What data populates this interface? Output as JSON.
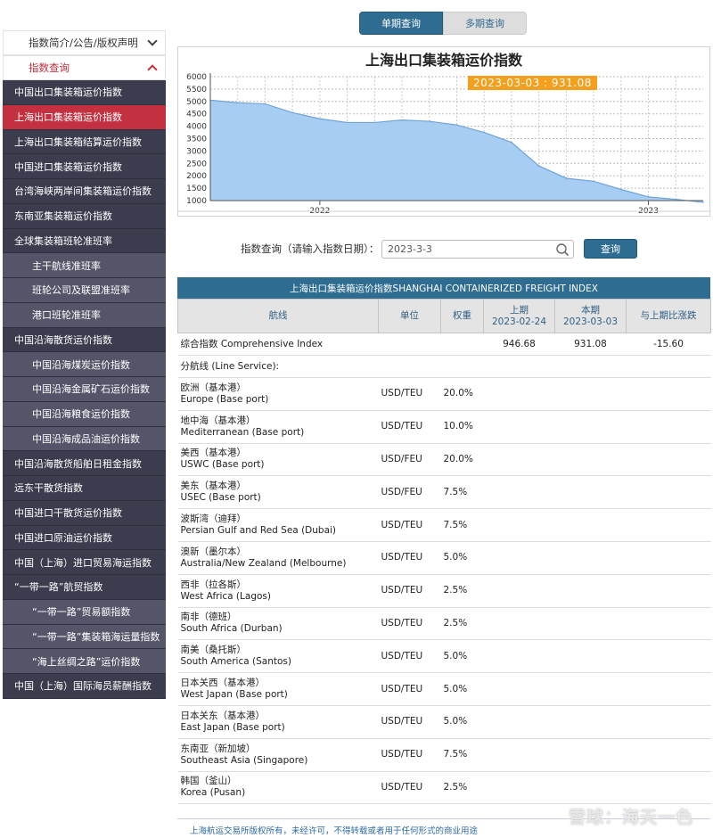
{
  "sidebar": {
    "top": [
      {
        "label": "指数简介/公告/版权声明",
        "active": false
      },
      {
        "label": "指数查询",
        "active": true
      }
    ],
    "items": [
      {
        "label": "中国出口集装箱运价指数",
        "level": 1
      },
      {
        "label": "上海出口集装箱运价指数",
        "level": 1,
        "selected": true
      },
      {
        "label": "上海出口集装箱结算运价指数",
        "level": 1
      },
      {
        "label": "中国进口集装箱运价指数",
        "level": 1
      },
      {
        "label": "台湾海峡两岸间集装箱运价指数",
        "level": 1
      },
      {
        "label": "东南亚集装箱运价指数",
        "level": 1
      },
      {
        "label": "全球集装箱班轮准班率",
        "level": 1
      },
      {
        "label": "主干航线准班率",
        "level": 2
      },
      {
        "label": "班轮公司及联盟准班率",
        "level": 2
      },
      {
        "label": "港口班轮准班率",
        "level": 2
      },
      {
        "label": "中国沿海散货运价指数",
        "level": 1
      },
      {
        "label": "中国沿海煤炭运价指数",
        "level": 2
      },
      {
        "label": "中国沿海金属矿石运价指数",
        "level": 2
      },
      {
        "label": "中国沿海粮食运价指数",
        "level": 2
      },
      {
        "label": "中国沿海成品油运价指数",
        "level": 2
      },
      {
        "label": "中国沿海散货船舶日租金指数",
        "level": 1
      },
      {
        "label": "远东干散货指数",
        "level": 1
      },
      {
        "label": "中国进口干散货运价指数",
        "level": 1
      },
      {
        "label": "中国进口原油运价指数",
        "level": 1
      },
      {
        "label": "中国（上海）进口贸易海运指数",
        "level": 1
      },
      {
        "label": "“一带一路”航贸指数",
        "level": 1
      },
      {
        "label": "“一带一路”贸易额指数",
        "level": 2
      },
      {
        "label": "“一带一路”集装箱海运量指数",
        "level": 2
      },
      {
        "label": "“海上丝绸之路”运价指数",
        "level": 2
      },
      {
        "label": "中国（上海）国际海员薪酬指数",
        "level": 1
      }
    ]
  },
  "tabs": {
    "single": "单期查询",
    "multi": "多期查询"
  },
  "chart_data": {
    "type": "area",
    "title": "上海出口集装箱运价指数",
    "tooltip": "2023-03-03 : 931.08",
    "ylim": [
      1000,
      6000
    ],
    "yticks": [
      1000,
      1500,
      2000,
      2500,
      3000,
      3500,
      4000,
      4500,
      5000,
      5500,
      6000
    ],
    "xtick_labels": [
      "2022",
      "2023"
    ],
    "grid": true,
    "color": "#a8cdf2",
    "line_color": "#6fa4d8",
    "x": [
      "2021-09",
      "2021-10",
      "2021-11",
      "2021-12",
      "2022-01",
      "2022-02",
      "2022-03",
      "2022-04",
      "2022-05",
      "2022-06",
      "2022-07",
      "2022-08",
      "2022-09",
      "2022-10",
      "2022-11",
      "2022-12",
      "2023-01",
      "2023-02",
      "2023-03"
    ],
    "values": [
      5050,
      4950,
      4900,
      4550,
      4300,
      4150,
      4150,
      4250,
      4200,
      4050,
      3750,
      3350,
      2400,
      1900,
      1780,
      1450,
      1150,
      1050,
      931
    ]
  },
  "query": {
    "label": "指数查询（请输入指数日期）：",
    "value": "2023-3-3",
    "button": "查询"
  },
  "table": {
    "title": "上海出口集装箱运价指数SHANGHAI CONTAINERIZED FREIGHT INDEX",
    "headers": {
      "route": "航线",
      "unit": "单位",
      "weight": "权重",
      "prev": "上期",
      "prev_date": "2023-02-24",
      "curr": "本期",
      "curr_date": "2023-03-03",
      "change": "与上期比涨跌"
    },
    "summary": {
      "name": "综合指数 Comprehensive Index",
      "prev": "946.68",
      "curr": "931.08",
      "change": "-15.60"
    },
    "group_label": "分航线 (Line Service):",
    "routes": [
      {
        "cn": "欧洲（基本港）",
        "en": "Europe (Base port)",
        "unit": "USD/TEU",
        "weight": "20.0%"
      },
      {
        "cn": "地中海（基本港）",
        "en": "Mediterranean (Base port)",
        "unit": "USD/TEU",
        "weight": "10.0%"
      },
      {
        "cn": "美西（基本港）",
        "en": "USWC (Base port)",
        "unit": "USD/FEU",
        "weight": "20.0%"
      },
      {
        "cn": "美东（基本港）",
        "en": "USEC (Base port)",
        "unit": "USD/FEU",
        "weight": "7.5%"
      },
      {
        "cn": "波斯湾（迪拜）",
        "en": "Persian Gulf and Red Sea (Dubai)",
        "unit": "USD/TEU",
        "weight": "7.5%"
      },
      {
        "cn": "澳新（墨尔本）",
        "en": "Australia/New Zealand (Melbourne)",
        "unit": "USD/TEU",
        "weight": "5.0%"
      },
      {
        "cn": "西非（拉各斯）",
        "en": "West Africa (Lagos)",
        "unit": "USD/TEU",
        "weight": "2.5%"
      },
      {
        "cn": "南非（德班）",
        "en": "South Africa (Durban)",
        "unit": "USD/TEU",
        "weight": "2.5%"
      },
      {
        "cn": "南美（桑托斯）",
        "en": "South America (Santos)",
        "unit": "USD/TEU",
        "weight": "5.0%"
      },
      {
        "cn": "日本关西（基本港）",
        "en": "West Japan (Base port)",
        "unit": "USD/TEU",
        "weight": "5.0%"
      },
      {
        "cn": "日本关东（基本港）",
        "en": "East Japan (Base port)",
        "unit": "USD/TEU",
        "weight": "5.0%"
      },
      {
        "cn": "东南亚（新加坡）",
        "en": "Southeast Asia (Singapore)",
        "unit": "USD/TEU",
        "weight": "7.5%"
      },
      {
        "cn": "韩国（釜山）",
        "en": "Korea (Pusan)",
        "unit": "USD/TEU",
        "weight": "2.5%"
      }
    ]
  },
  "footer": "上海航运交易所版权所有，未经许可，不得转载或者用于任何形式的商业用途",
  "watermark": "雪球：海天一色"
}
